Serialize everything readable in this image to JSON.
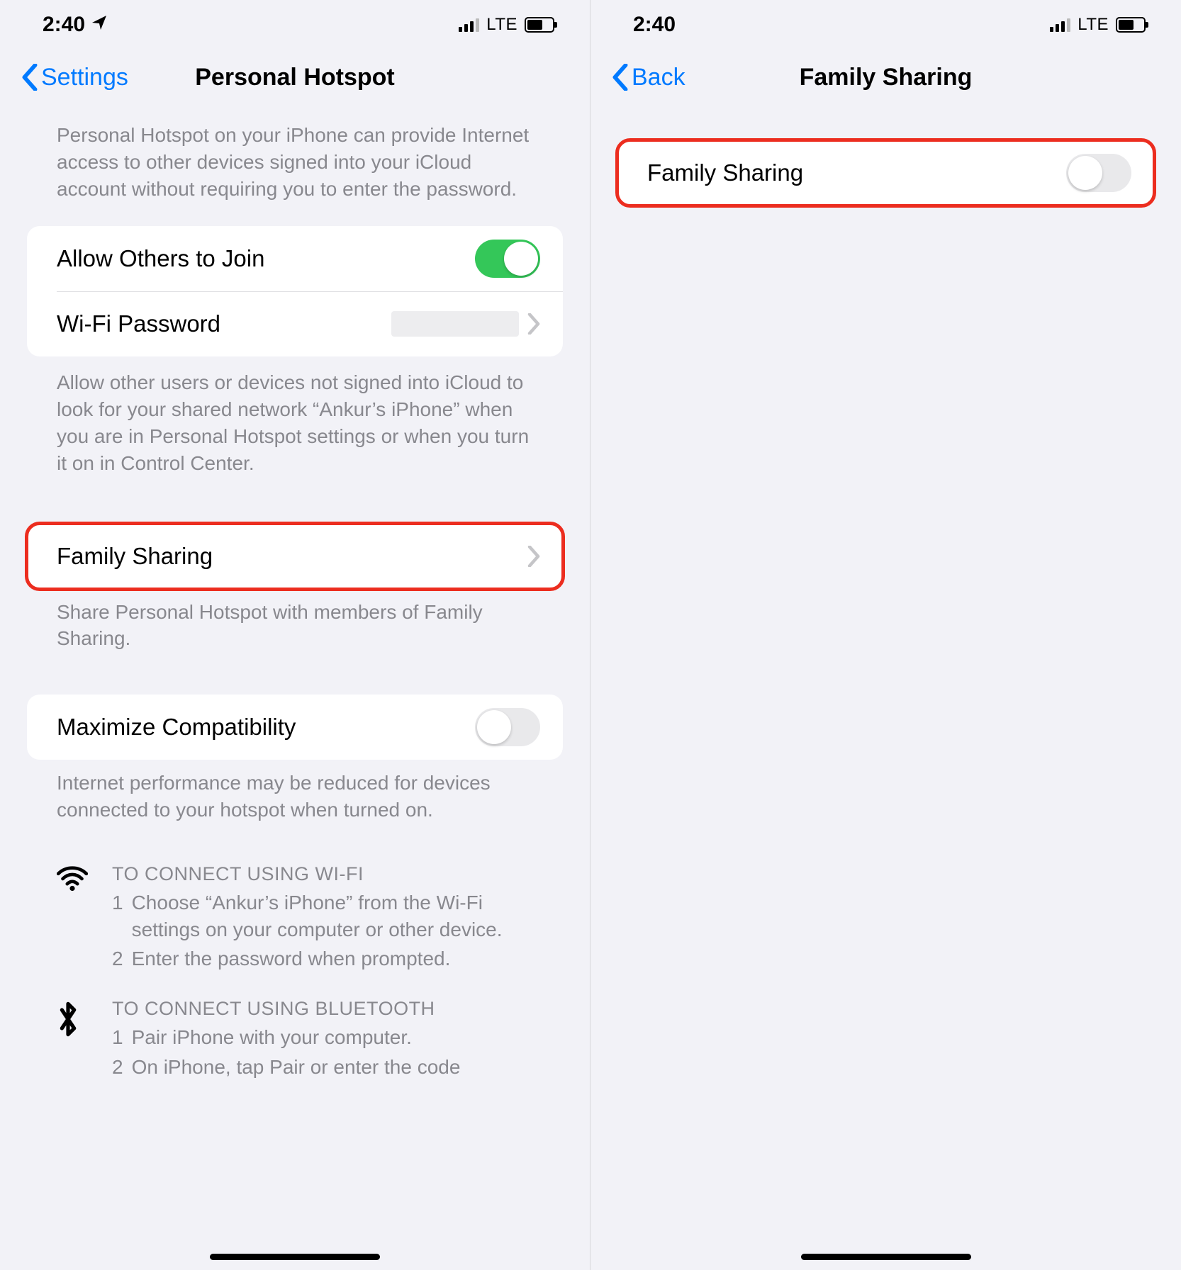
{
  "status": {
    "time": "2:40",
    "network": "LTE"
  },
  "left": {
    "back": "Settings",
    "title": "Personal Hotspot",
    "intro": "Personal Hotspot on your iPhone can provide Internet access to other devices signed into your iCloud account without requiring you to enter the password.",
    "allow_others": "Allow Others to Join",
    "wifi_password": "Wi-Fi Password",
    "allow_footer": "Allow other users or devices not signed into iCloud to look for your shared network “Ankur’s iPhone” when you are in Personal Hotspot settings or when you turn it on in Control Center.",
    "family_sharing": "Family Sharing",
    "family_footer": "Share Personal Hotspot with members of Family Sharing.",
    "max_compat": "Maximize Compatibility",
    "max_footer": "Internet performance may be reduced for devices connected to your hotspot when turned on.",
    "wifi_title": "TO CONNECT USING WI-FI",
    "wifi_step1": "Choose “Ankur’s iPhone” from the Wi-Fi settings on your computer or other device.",
    "wifi_step2": "Enter the password when prompted.",
    "bt_title": "TO CONNECT USING BLUETOOTH",
    "bt_step1": "Pair iPhone with your computer.",
    "bt_step2": "On iPhone, tap Pair or enter the code"
  },
  "right": {
    "back": "Back",
    "title": "Family Sharing",
    "row": "Family Sharing"
  }
}
